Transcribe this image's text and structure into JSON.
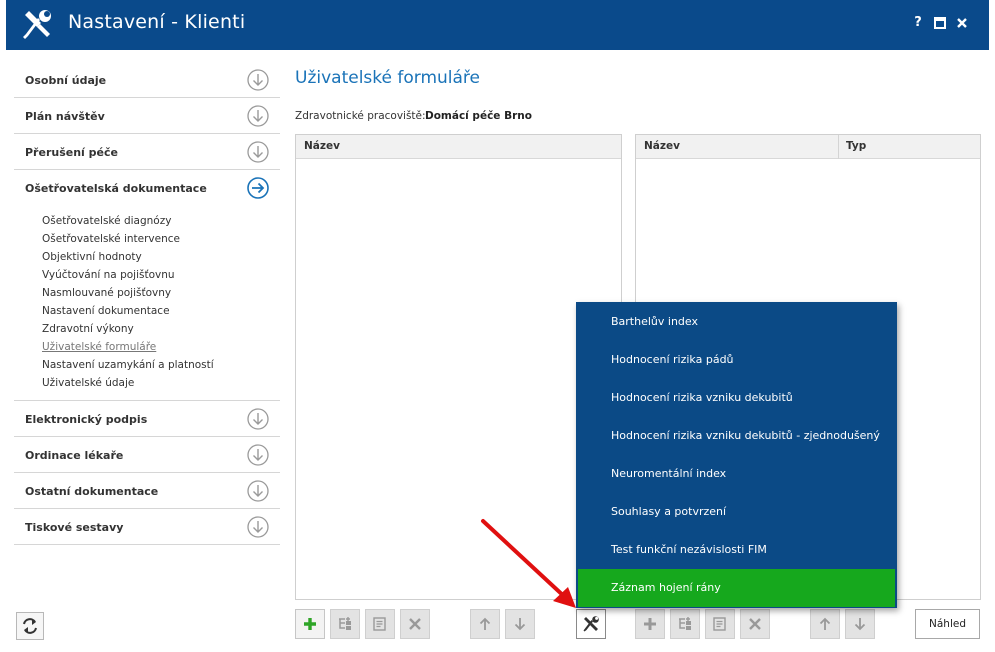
{
  "window": {
    "title": "Nastavení - Klienti",
    "controls": [
      "?",
      "maximize",
      "close"
    ]
  },
  "sidebar": {
    "sections_top": [
      {
        "label": "Osobní údaje"
      },
      {
        "label": "Plán návštěv"
      },
      {
        "label": "Přerušení péče"
      },
      {
        "label": "Ošetřovatelská dokumentace",
        "expanded": true
      }
    ],
    "subitems": [
      "Ošetřovatelské diagnózy",
      "Ošetřovatelské intervence",
      "Objektivní hodnoty",
      "Vyúčtování na pojišťovnu",
      "Nasmlouvané pojišťovny",
      "Nastavení dokumentace",
      "Zdravotní výkony",
      "Uživatelské formuláře",
      "Nastavení uzamykání a platností",
      "Uživatelské údaje"
    ],
    "active_subitem": "Uživatelské formuláře",
    "sections_bottom": [
      {
        "label": "Elektronický podpis"
      },
      {
        "label": "Ordinace lékaře"
      },
      {
        "label": "Ostatní dokumentace"
      },
      {
        "label": "Tiskové sestavy"
      }
    ]
  },
  "main": {
    "title": "Uživatelské formuláře",
    "workplace_label": "Zdravotnické pracoviště:",
    "workplace_value": "Domácí péče Brno",
    "left_panel": {
      "columns": [
        "Název"
      ]
    },
    "right_panel": {
      "columns": [
        "Název",
        "Typ"
      ]
    },
    "preview_button": "Náhled"
  },
  "dropdown": {
    "items": [
      "Barthelův index",
      "Hodnocení rizika pádů",
      "Hodnocení rizika vzniku dekubitů",
      "Hodnocení rizika vzniku dekubitů - zjednodušený",
      "Neuromentální index",
      "Souhlasy a potvrzení",
      "Test funkční nezávislosti FIM",
      "Záznam hojení rány"
    ],
    "highlighted": "Záznam hojení rány"
  },
  "colors": {
    "titlebar": "#0a4a8b",
    "accent": "#1a73b8",
    "menu": "#0b4a86",
    "menu_highlight": "#16a81d",
    "pointer": "#e01010"
  }
}
